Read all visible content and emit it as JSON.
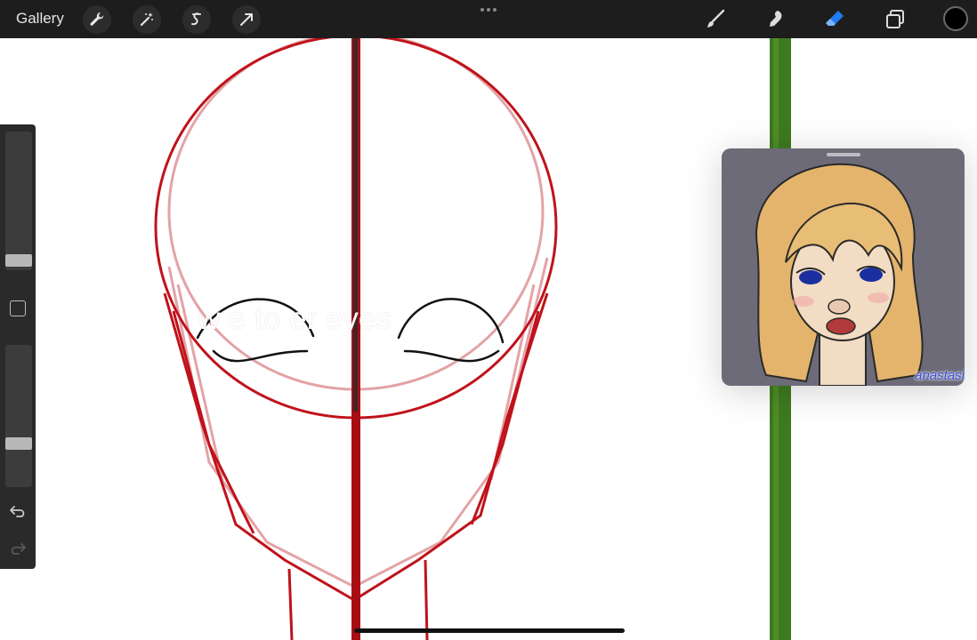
{
  "topbar": {
    "gallery_label": "Gallery",
    "left_tools": [
      "wrench-icon",
      "magic-wand-icon",
      "selection-icon",
      "transform-arrow-icon"
    ],
    "right_tools": [
      "brush-icon",
      "smudge-icon",
      "eraser-icon",
      "layers-icon"
    ],
    "current_color": "#000000",
    "active_tool_color": "#1e7bf0"
  },
  "caption": {
    "text": "w       e            to         er eyes"
  },
  "reference": {
    "watermark": "anastasi"
  },
  "colors": {
    "guide_red": "#c0121b",
    "guide_pink": "#e3a3a6",
    "stripe_green": "#3e7a1f",
    "ui_dark": "#1d1d1d"
  }
}
